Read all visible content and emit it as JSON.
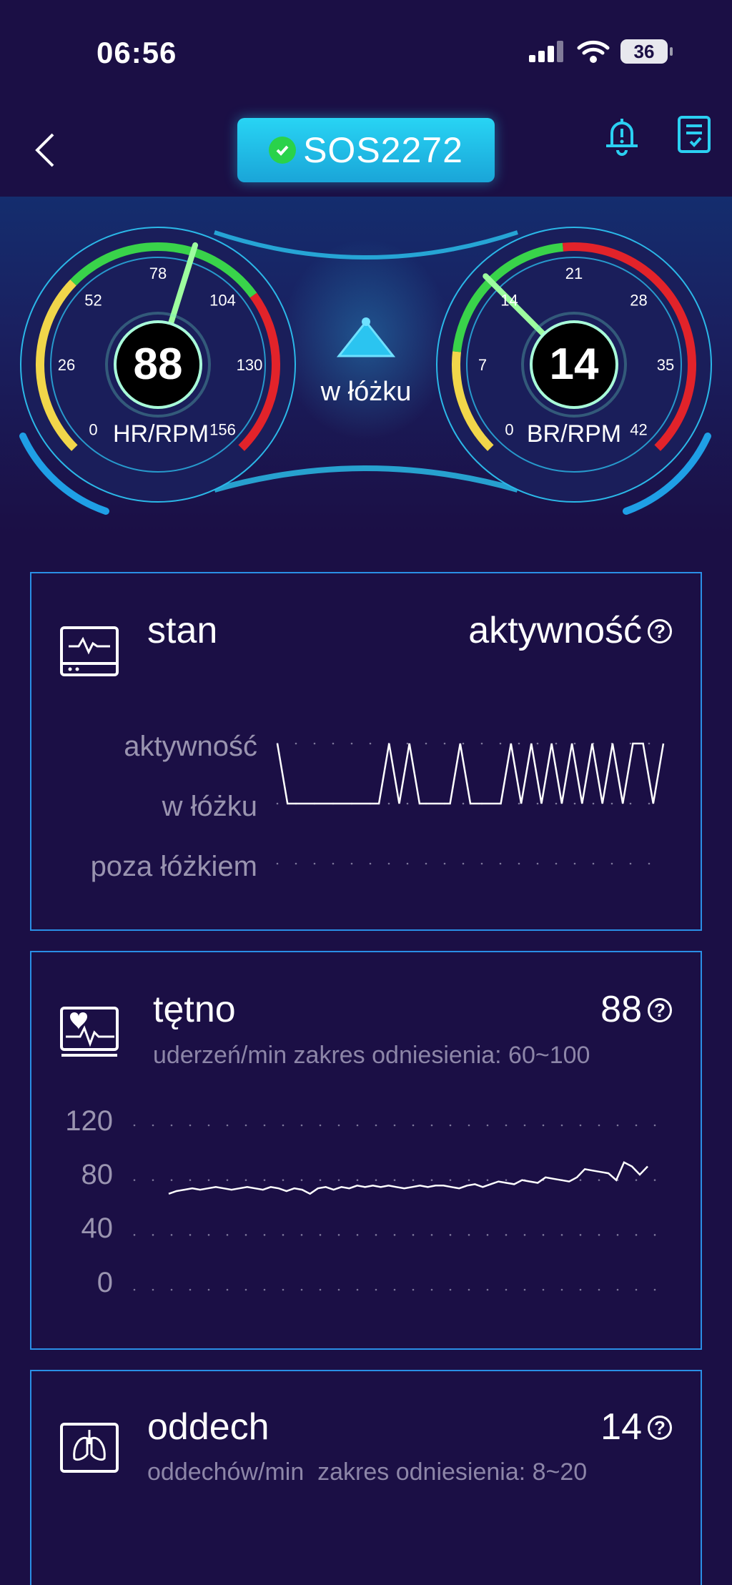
{
  "status_bar": {
    "time": "06:56",
    "battery": "36",
    "icons": [
      "signal-icon",
      "wifi-icon",
      "battery-icon"
    ]
  },
  "header": {
    "device_name": "SOS2272",
    "back": "chevron-left-icon",
    "alarm": "bell-icon",
    "report": "report-icon"
  },
  "dashboard": {
    "heart_gauge": {
      "value": "88",
      "unit": "HR/RPM",
      "ticks": [
        "0",
        "26",
        "52",
        "78",
        "104",
        "130",
        "156"
      ],
      "max": 156,
      "current": 88
    },
    "breath_gauge": {
      "value": "14",
      "unit": "BR/RPM",
      "ticks": [
        "0",
        "7",
        "14",
        "21",
        "28",
        "35",
        "42"
      ],
      "max": 42,
      "current": 14
    },
    "center_status": "w łóżku",
    "colors": {
      "green": "#39d34a",
      "yellow": "#f1d64a",
      "red": "#e2232a",
      "ring": "#2bb8e8"
    }
  },
  "status_panel": {
    "title": "stan",
    "value": "aktywność",
    "rows": [
      "aktywność",
      "w łóżku",
      "poza łóżkiem"
    ],
    "chart_data": {
      "type": "line",
      "categories": [
        "aktywność",
        "w łóżku",
        "poza łóżkiem"
      ],
      "values": [
        0,
        1,
        1,
        1,
        1,
        1,
        1,
        1,
        1,
        1,
        1,
        0,
        1,
        0,
        1,
        1,
        1,
        1,
        0,
        1,
        1,
        1,
        1,
        0,
        1,
        0,
        1,
        0,
        1,
        0,
        1,
        0,
        1,
        0,
        1,
        0,
        0,
        1,
        0
      ]
    }
  },
  "heart_panel": {
    "title": "tętno",
    "value": "88",
    "subtitle": "uderzeń/min zakres odniesienia: 60~100",
    "y_ticks": [
      "120",
      "80",
      "40",
      "0"
    ],
    "chart_data": {
      "type": "line",
      "ylim": [
        0,
        120
      ],
      "values": [
        70,
        72,
        73,
        74,
        73,
        74,
        75,
        74,
        73,
        74,
        75,
        74,
        73,
        75,
        74,
        72,
        74,
        73,
        70,
        74,
        75,
        73,
        75,
        74,
        76,
        75,
        76,
        75,
        76,
        75,
        74,
        75,
        76,
        75,
        76,
        76,
        75,
        74,
        76,
        77,
        75,
        77,
        79,
        78,
        77,
        80,
        79,
        78,
        82,
        81,
        80,
        79,
        82,
        88,
        87,
        86,
        85,
        80,
        93,
        90,
        84,
        90
      ]
    }
  },
  "breath_panel": {
    "title": "oddech",
    "value": "14",
    "subtitle": "oddechów/min  zakres odniesienia: 8~20"
  }
}
